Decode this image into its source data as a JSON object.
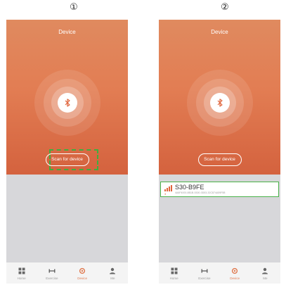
{
  "steps": [
    "①",
    "②"
  ],
  "screens": [
    {
      "title": "Device",
      "scan_label": "Scan for device"
    },
    {
      "title": "Device",
      "scan_label": "Scan for device",
      "device": {
        "name": "S30-B9FE",
        "id": "4A6F4000-8B1B-5300-0D53-32C874A59F88",
        "count": "3"
      }
    }
  ],
  "tabs": [
    "Home",
    "Exercise",
    "Device",
    "Me"
  ],
  "colors": {
    "accent": "#e07a50",
    "highlight": "#3fae3f"
  }
}
